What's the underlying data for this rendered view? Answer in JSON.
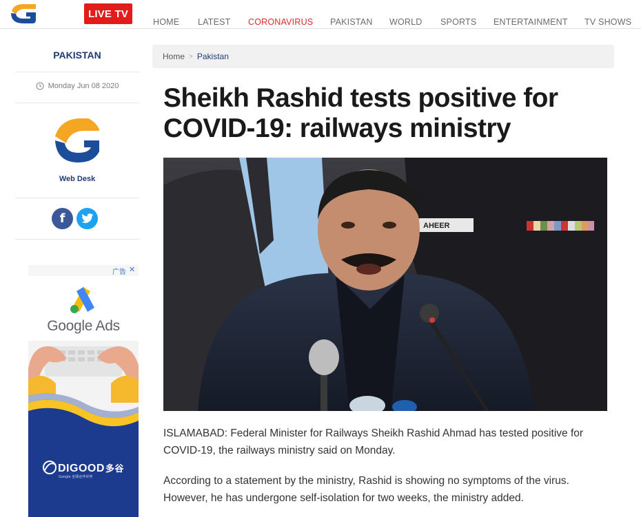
{
  "header": {
    "logo_name": "geo-news-logo",
    "live_label": "LIVE TV",
    "nav": [
      {
        "label": "HOME",
        "active": false
      },
      {
        "label": "LATEST",
        "active": false
      },
      {
        "label": "CORONAVIRUS",
        "active": true
      },
      {
        "label": "PAKISTAN",
        "active": false
      },
      {
        "label": "WORLD",
        "active": false
      },
      {
        "label": "SPORTS",
        "active": false
      },
      {
        "label": "ENTERTAINMENT",
        "active": false
      },
      {
        "label": "TV SHOWS",
        "active": false
      }
    ]
  },
  "sidebar": {
    "category": "PAKISTAN",
    "date": "Monday Jun 08 2020",
    "author": "Web Desk",
    "social": [
      "facebook",
      "twitter"
    ]
  },
  "ad": {
    "badge": "广告",
    "close": "✕",
    "title": "Google Ads",
    "brand": "DIGOOD",
    "brand_cn": "多谷",
    "brand_sub": "Google 全球合作伙伴"
  },
  "breadcrumb": {
    "home": "Home",
    "separator": ">",
    "current": "Pakistan"
  },
  "article": {
    "title": "Sheikh Rashid tests positive for COVID-19: railways ministry",
    "image_name_tag": "AHEER",
    "paragraphs": [
      "ISLAMABAD: Federal Minister for Railways Sheikh Rashid Ahmad has tested positive for COVID-19, the railways ministry said on Monday.",
      "According to a statement by the ministry, Rashid is showing no symptoms of the virus. However, he has undergone self-isolation for two weeks, the ministry added."
    ]
  },
  "colors": {
    "accent": "#e21b1b",
    "brand_blue": "#1f3b75",
    "nav_text": "#6b6b6b"
  }
}
